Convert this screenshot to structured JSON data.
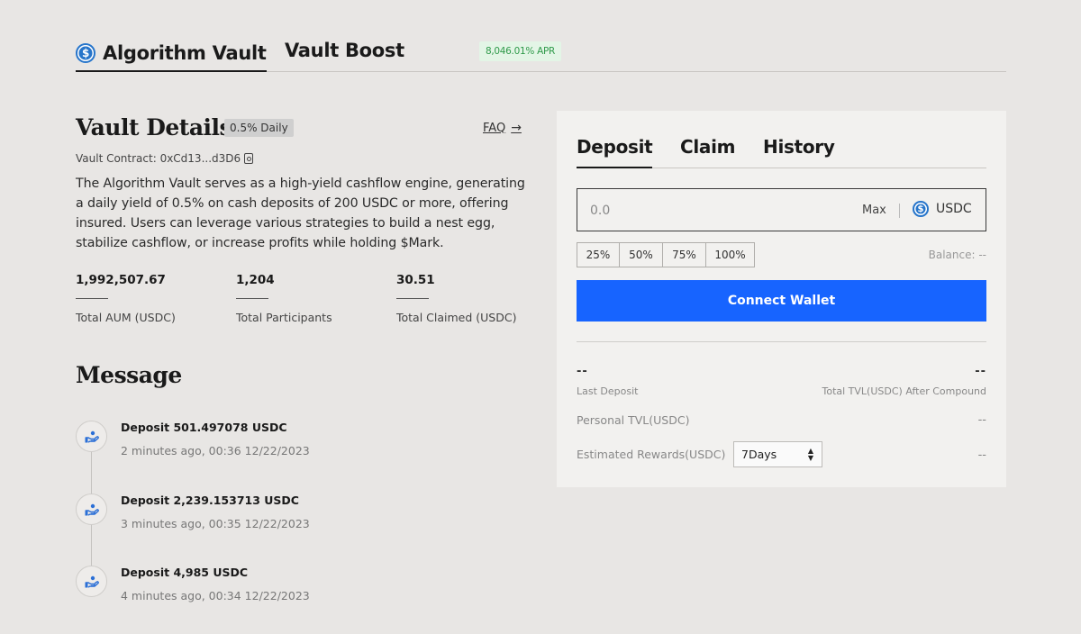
{
  "top_tabs": {
    "vault": "Algorithm Vault",
    "boost": "Vault Boost",
    "apr": "8,046.01% APR"
  },
  "details": {
    "title": "Vault Details",
    "daily_badge": "0.5% Daily",
    "faq": "FAQ",
    "contract": "Vault Contract: 0xCd13...d3D6",
    "description": "The Algorithm Vault serves as a high-yield cashflow engine, generating a daily yield of 0.5% on cash deposits of 200 USDC or more, offering insured. Users can leverage various strategies to build a nest egg, stabilize cashflow, or increase profits while holding $Mark.",
    "stats": [
      {
        "value": "1,992,507.67",
        "label": "Total AUM (USDC)"
      },
      {
        "value": "1,204",
        "label": "Total Participants"
      },
      {
        "value": "30.51",
        "label": "Total Claimed (USDC)"
      }
    ]
  },
  "messages": {
    "title": "Message",
    "items": [
      {
        "head": "Deposit 501.497078 USDC",
        "time": "2 minutes ago, 00:36 12/22/2023"
      },
      {
        "head": "Deposit 2,239.153713 USDC",
        "time": "3 minutes ago, 00:35 12/22/2023"
      },
      {
        "head": "Deposit 4,985 USDC",
        "time": "4 minutes ago, 00:34 12/22/2023"
      }
    ]
  },
  "panel": {
    "tabs": {
      "deposit": "Deposit",
      "claim": "Claim",
      "history": "History"
    },
    "amount_placeholder": "0.0",
    "max": "Max",
    "token": "USDC",
    "percents": [
      "25%",
      "50%",
      "75%",
      "100%"
    ],
    "balance": "Balance: --",
    "connect": "Connect Wallet",
    "last_deposit_value": "--",
    "last_deposit_label": "Last Deposit",
    "tvl_after_value": "--",
    "tvl_after_label": "Total TVL(USDC) After Compound",
    "personal_tvl_label": "Personal TVL(USDC)",
    "personal_tvl_value": "--",
    "est_rewards_label": "Estimated Rewards(USDC)",
    "est_rewards_period": "7Days",
    "est_rewards_value": "--"
  },
  "colors": {
    "accent_blue": "#1764ff",
    "usdc_blue": "#2775ca",
    "apr_green": "#2f9a4a"
  }
}
